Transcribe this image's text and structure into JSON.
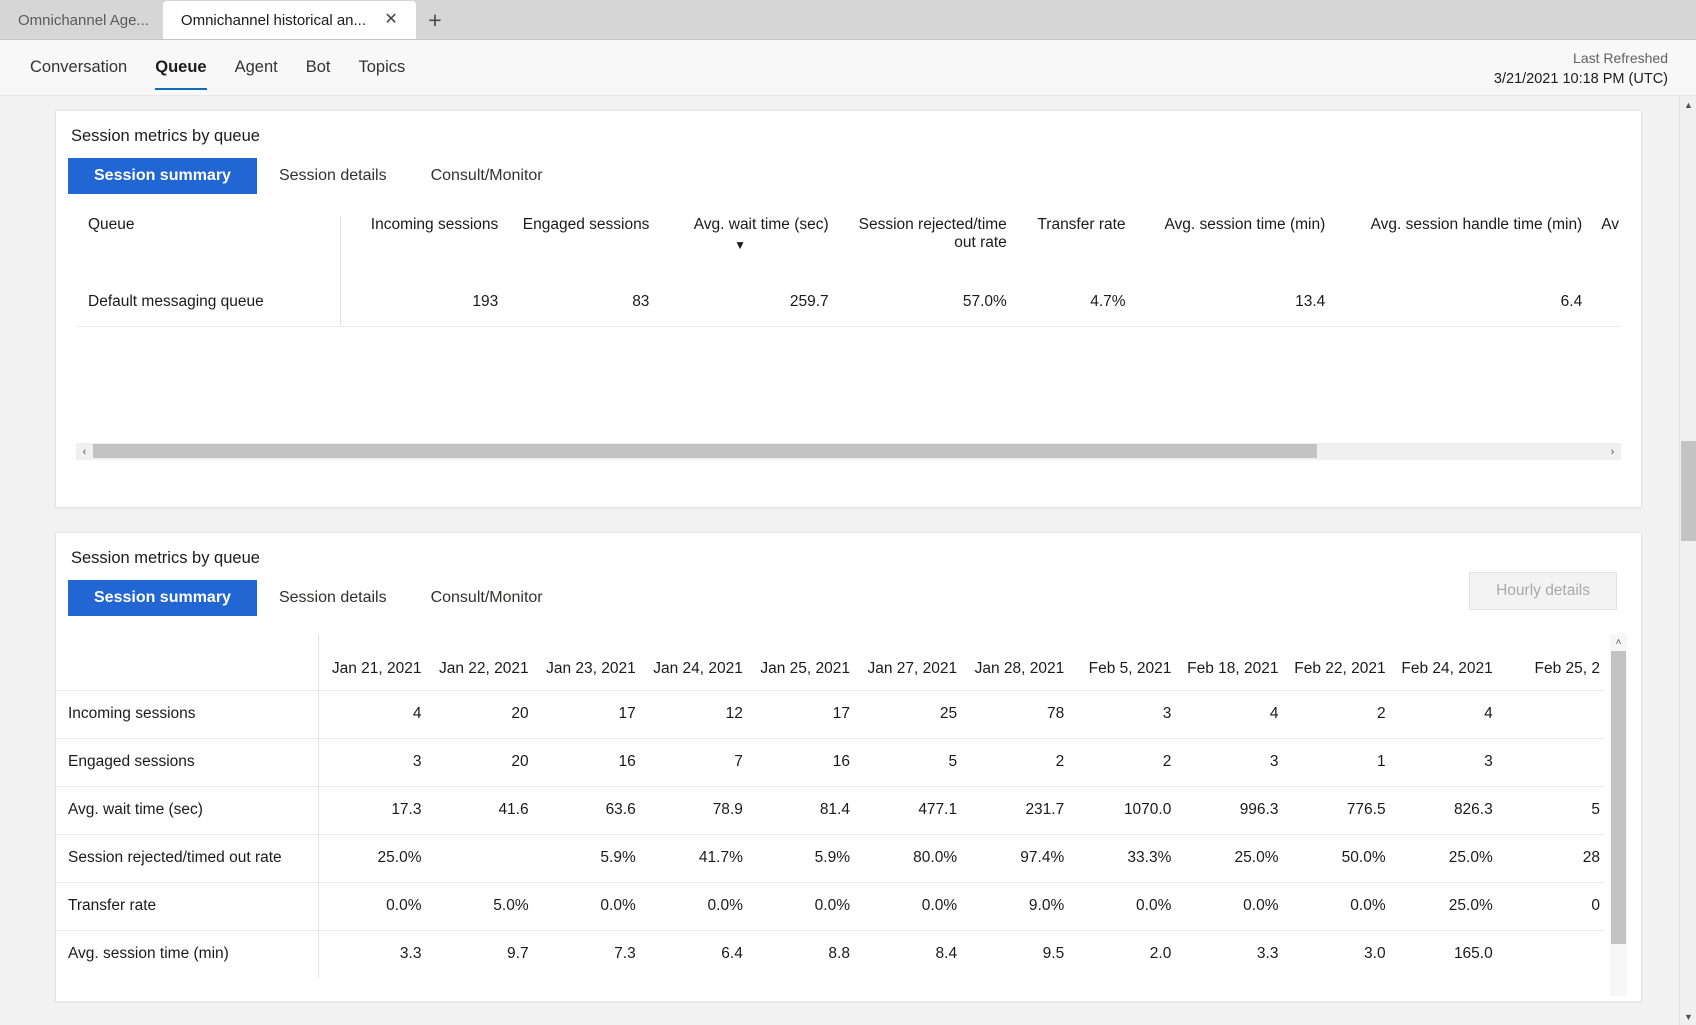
{
  "browser": {
    "tabs": [
      {
        "title": "Omnichannel Age...",
        "active": false
      },
      {
        "title": "Omnichannel historical an...",
        "active": true
      }
    ],
    "close_glyph": "✕",
    "new_tab_glyph": "+"
  },
  "header": {
    "nav_tabs": [
      {
        "label": "Conversation",
        "selected": false
      },
      {
        "label": "Queue",
        "selected": true
      },
      {
        "label": "Agent",
        "selected": false
      },
      {
        "label": "Bot",
        "selected": false
      },
      {
        "label": "Topics",
        "selected": false
      }
    ],
    "last_refreshed_label": "Last Refreshed",
    "last_refreshed_value": "3/21/2021 10:18 PM (UTC)"
  },
  "accent_color": "#2266d3",
  "card1": {
    "title": "Session metrics by queue",
    "pivots": [
      {
        "label": "Session summary",
        "active": true
      },
      {
        "label": "Session details",
        "active": false
      },
      {
        "label": "Consult/Monitor",
        "active": false
      }
    ],
    "table": {
      "columns": [
        {
          "label": "Queue",
          "line2": "",
          "sorted": false
        },
        {
          "label": "Incoming sessions",
          "line2": "",
          "sorted": false
        },
        {
          "label": "Engaged sessions",
          "line2": "",
          "sorted": false
        },
        {
          "label": "Avg. wait time (sec)",
          "line2": "",
          "sorted": true
        },
        {
          "label": "Session rejected/time",
          "line2": "out rate",
          "sorted": false
        },
        {
          "label": "Transfer rate",
          "line2": "",
          "sorted": false
        },
        {
          "label": "Avg. session time (min)",
          "line2": "",
          "sorted": false
        },
        {
          "label": "Avg. session handle time (min)",
          "line2": "",
          "sorted": false
        },
        {
          "label": "Av",
          "line2": "",
          "sorted": false
        }
      ],
      "sort_caret": "▼",
      "rows": [
        {
          "queue": "Default messaging queue",
          "values": [
            "193",
            "83",
            "259.7",
            "57.0%",
            "4.7%",
            "13.4",
            "6.4"
          ]
        }
      ]
    },
    "hscrollbar": {
      "left_arrow": "‹",
      "right_arrow": "›",
      "thumb_percent": 81
    }
  },
  "card2": {
    "title": "Session metrics by queue",
    "pivots": [
      {
        "label": "Session summary",
        "active": true
      },
      {
        "label": "Session details",
        "active": false
      },
      {
        "label": "Consult/Monitor",
        "active": false
      }
    ],
    "hourly_details_label": "Hourly details",
    "table": {
      "row_header_blank": "",
      "date_columns": [
        "Jan 21, 2021",
        "Jan 22, 2021",
        "Jan 23, 2021",
        "Jan 24, 2021",
        "Jan 25, 2021",
        "Jan 27, 2021",
        "Jan 28, 2021",
        "Feb 5, 2021",
        "Feb 18, 2021",
        "Feb 22, 2021",
        "Feb 24, 2021",
        "Feb 25, 2"
      ],
      "rows": [
        {
          "metric": "Incoming sessions",
          "values": [
            "4",
            "20",
            "17",
            "12",
            "17",
            "25",
            "78",
            "3",
            "4",
            "2",
            "4",
            ""
          ]
        },
        {
          "metric": "Engaged sessions",
          "values": [
            "3",
            "20",
            "16",
            "7",
            "16",
            "5",
            "2",
            "2",
            "3",
            "1",
            "3",
            ""
          ]
        },
        {
          "metric": "Avg. wait time (sec)",
          "values": [
            "17.3",
            "41.6",
            "63.6",
            "78.9",
            "81.4",
            "477.1",
            "231.7",
            "1070.0",
            "996.3",
            "776.5",
            "826.3",
            "5"
          ]
        },
        {
          "metric": "Session rejected/timed out rate",
          "values": [
            "25.0%",
            "",
            "5.9%",
            "41.7%",
            "5.9%",
            "80.0%",
            "97.4%",
            "33.3%",
            "25.0%",
            "50.0%",
            "25.0%",
            "28"
          ]
        },
        {
          "metric": "Transfer rate",
          "values": [
            "0.0%",
            "5.0%",
            "0.0%",
            "0.0%",
            "0.0%",
            "0.0%",
            "9.0%",
            "0.0%",
            "0.0%",
            "0.0%",
            "25.0%",
            "0"
          ]
        },
        {
          "metric": "Avg. session time (min)",
          "values": [
            "3.3",
            "9.7",
            "7.3",
            "6.4",
            "8.8",
            "8.4",
            "9.5",
            "2.0",
            "3.3",
            "3.0",
            "165.0",
            ""
          ]
        }
      ]
    },
    "vscrollbar": {
      "up_arrow": "˄",
      "down_arrow": "˅"
    }
  },
  "page_scrollbar": {
    "up_arrow": "▲",
    "down_arrow": "▼"
  }
}
